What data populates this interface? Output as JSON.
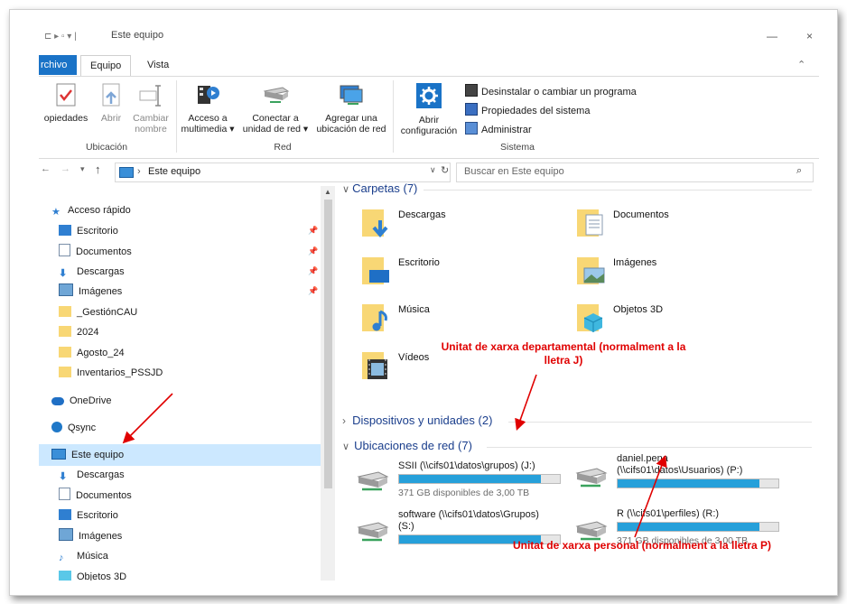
{
  "window": {
    "title": "Este equipo"
  },
  "ribbon": {
    "tabs": [
      {
        "label": "rchivo"
      },
      {
        "label": "Equipo"
      },
      {
        "label": "Vista"
      }
    ],
    "groups": {
      "ubicacion": {
        "label": "Ubicación",
        "buttons": [
          {
            "label": "opiedades"
          },
          {
            "label": "Abrir"
          },
          {
            "label_line1": "Cambiar",
            "label_line2": "nombre"
          }
        ]
      },
      "red": {
        "label": "Red",
        "buttons": [
          {
            "label_line1": "Acceso a",
            "label_line2": "multimedia ▾"
          },
          {
            "label_line1": "Conectar a",
            "label_line2": "unidad de red ▾"
          },
          {
            "label_line1": "Agregar una",
            "label_line2": "ubicación de red"
          }
        ]
      },
      "sistema": {
        "label": "Sistema",
        "big_button": {
          "label_line1": "Abrir",
          "label_line2": "configuración"
        },
        "small_buttons": [
          {
            "label": "Desinstalar o cambiar un programa"
          },
          {
            "label": "Propiedades del sistema"
          },
          {
            "label": "Administrar"
          }
        ]
      }
    }
  },
  "addressbar": {
    "path": "Este equipo",
    "search_placeholder": "Buscar en Este equipo"
  },
  "nav": {
    "quick_access": "Acceso rápido",
    "items": [
      {
        "label": "Escritorio",
        "pinned": true
      },
      {
        "label": "Documentos",
        "pinned": true
      },
      {
        "label": "Descargas",
        "pinned": true
      },
      {
        "label": "Imágenes",
        "pinned": true
      },
      {
        "label": "_GestiónCAU"
      },
      {
        "label": "2024"
      },
      {
        "label": "Agosto_24"
      },
      {
        "label": "Inventarios_PSSJD"
      }
    ],
    "onedrive": "OneDrive",
    "qsync": "Qsync",
    "this_pc": "Este equipo",
    "pc_items": [
      {
        "label": "Descargas"
      },
      {
        "label": "Documentos"
      },
      {
        "label": "Escritorio"
      },
      {
        "label": "Imágenes"
      },
      {
        "label": "Música"
      },
      {
        "label": "Objetos 3D"
      }
    ]
  },
  "content": {
    "folders_header": "Carpetas (7)",
    "folders": [
      {
        "label": "Descargas"
      },
      {
        "label": "Documentos"
      },
      {
        "label": "Escritorio"
      },
      {
        "label": "Imágenes"
      },
      {
        "label": "Música"
      },
      {
        "label": "Objetos 3D"
      },
      {
        "label": "Vídeos"
      }
    ],
    "devices_header": "Dispositivos y unidades (2)",
    "network_header": "Ubicaciones de red (7)",
    "drives": [
      {
        "name": "SSII (\\\\cifs01\\datos\\grupos) (J:)",
        "sub": "371 GB disponibles de 3,00 TB",
        "used_fraction": 0.88
      },
      {
        "name_line1": "daniel.pena",
        "name_line2": "(\\\\cifs01\\datos\\Usuarios) (P:)",
        "sub": "",
        "used_fraction": 0.88
      },
      {
        "name_line1": "software (\\\\cifs01\\datos\\Grupos)",
        "name_line2": "(S:)",
        "sub": "",
        "used_fraction": 0.88
      },
      {
        "name": "R (\\\\cifs01\\perfiles) (R:)",
        "sub": "371 GB disponibles de 3,00 TB",
        "used_fraction": 0.88
      }
    ]
  },
  "annotations": {
    "top_line1": "Unitat de xarxa departamental (normalment a la",
    "top_line2": "lletra J)",
    "bottom": "Unitat de xarxa personal (normalment a la lletra P)"
  },
  "colors": {
    "file_tab": "#1a73c7",
    "bar_fill": "#26a0da",
    "annotation": "#e00000",
    "section_header": "#1a3e8c"
  }
}
